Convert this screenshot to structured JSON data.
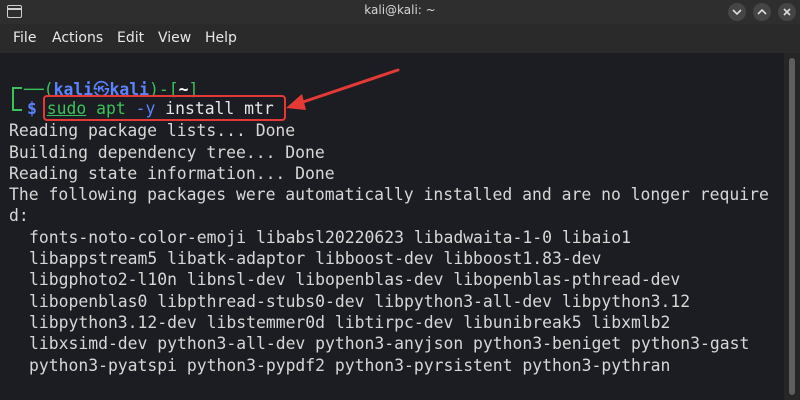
{
  "window": {
    "title": "kali@kali: ~",
    "controls": [
      "minimize",
      "maximize",
      "close"
    ]
  },
  "menu": {
    "items": [
      "File",
      "Actions",
      "Edit",
      "View",
      "Help"
    ]
  },
  "prompt": {
    "open": "(",
    "user": "kali",
    "at_icon": "㉿",
    "host": "kali",
    "close_dash": ")-[",
    "dir": "~",
    "close_bracket": "]",
    "symbol": "$"
  },
  "command": {
    "sudo": "sudo",
    "apt": "apt",
    "flag": "-y",
    "rest": "install mtr"
  },
  "output": {
    "lines": [
      "Reading package lists... Done",
      "Building dependency tree... Done",
      "Reading state information... Done",
      "The following packages were automatically installed and are no longer require",
      "d:"
    ],
    "packages": [
      "fonts-noto-color-emoji libabsl20220623 libadwaita-1-0 libaio1",
      "libappstream5 libatk-adaptor libboost-dev libboost1.83-dev",
      "libgphoto2-l10n libnsl-dev libopenblas-dev libopenblas-pthread-dev",
      "libopenblas0 libpthread-stubs0-dev libpython3-all-dev libpython3.12",
      "libpython3.12-dev libstemmer0d libtirpc-dev libunibreak5 libxmlb2",
      "libxsimd-dev python3-all-dev python3-anyjson python3-beniget python3-gast",
      "python3-pyatspi python3-pypdf2 python3-pyrsistent python3-pythran"
    ]
  },
  "colors": {
    "prompt_green": "#3ac35a",
    "prompt_blue": "#5a83ff",
    "annotation_red": "#e53935",
    "terminal_bg": "#1c1d23"
  }
}
